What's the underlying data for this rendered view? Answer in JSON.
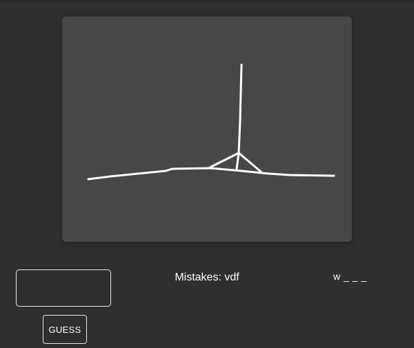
{
  "game": {
    "mistakes_label": "Mistakes: vdf",
    "word_display": "w _ _ _",
    "guess_button_label": "GUESS",
    "guess_input_value": "",
    "guess_input_placeholder": ""
  },
  "colors": {
    "background": "#2f2f2f",
    "canvas": "#474747",
    "stroke": "#ffffff"
  }
}
